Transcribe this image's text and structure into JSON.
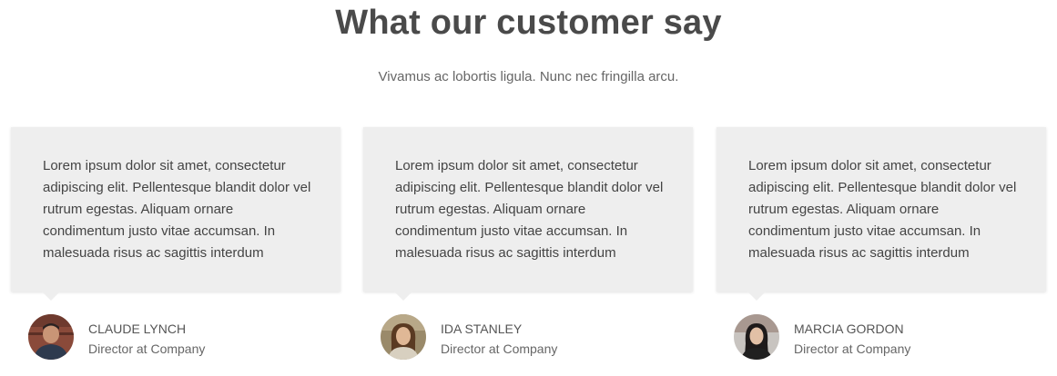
{
  "section": {
    "title": "What our customer say",
    "subtitle": "Vivamus ac lobortis ligula. Nunc nec fringilla arcu."
  },
  "testimonials": [
    {
      "quote": "Lorem ipsum dolor sit amet, consectetur adipiscing elit. Pellentesque blandit dolor vel rutrum egestas. Aliquam ornare condimentum justo vitae accumsan. In malesuada risus ac sagittis interdum",
      "name": "CLAUDE LYNCH",
      "role": "Director at Company"
    },
    {
      "quote": "Lorem ipsum dolor sit amet, consectetur adipiscing elit. Pellentesque blandit dolor vel rutrum egestas. Aliquam ornare condimentum justo vitae accumsan. In malesuada risus ac sagittis interdum",
      "name": "IDA STANLEY",
      "role": "Director at Company"
    },
    {
      "quote": "Lorem ipsum dolor sit amet, consectetur adipiscing elit. Pellentesque blandit dolor vel rutrum egestas. Aliquam ornare condimentum justo vitae accumsan. In malesuada risus ac sagittis interdum",
      "name": "MARCIA GORDON",
      "role": "Director at Company"
    }
  ],
  "colors": {
    "card_background": "#eeeeee",
    "heading": "#4a4a4a",
    "body_text": "#444444"
  }
}
